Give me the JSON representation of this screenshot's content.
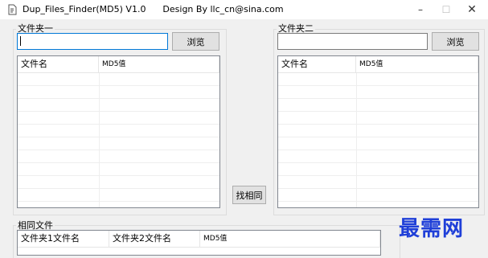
{
  "window": {
    "title": "Dup_Files_Finder(MD5) V1.0      Design By llc_cn@sina.com",
    "controls": {
      "minimize": "–",
      "maximize": "☐",
      "close": "✕"
    }
  },
  "folder1": {
    "label": "文件夹一",
    "path_value": "",
    "browse_label": "浏览",
    "columns": [
      "文件名",
      "MD5值"
    ]
  },
  "folder2": {
    "label": "文件夹二",
    "path_value": "",
    "browse_label": "浏览",
    "columns": [
      "文件名",
      "MD5值"
    ]
  },
  "find_same_label": "找相同",
  "results": {
    "label": "相同文件",
    "columns": [
      "文件夹1文件名",
      "文件夹2文件名",
      "MD5值"
    ]
  },
  "watermark": "最需网",
  "colors": {
    "watermark": "#1f3fd8",
    "focus_border": "#0078d7"
  }
}
